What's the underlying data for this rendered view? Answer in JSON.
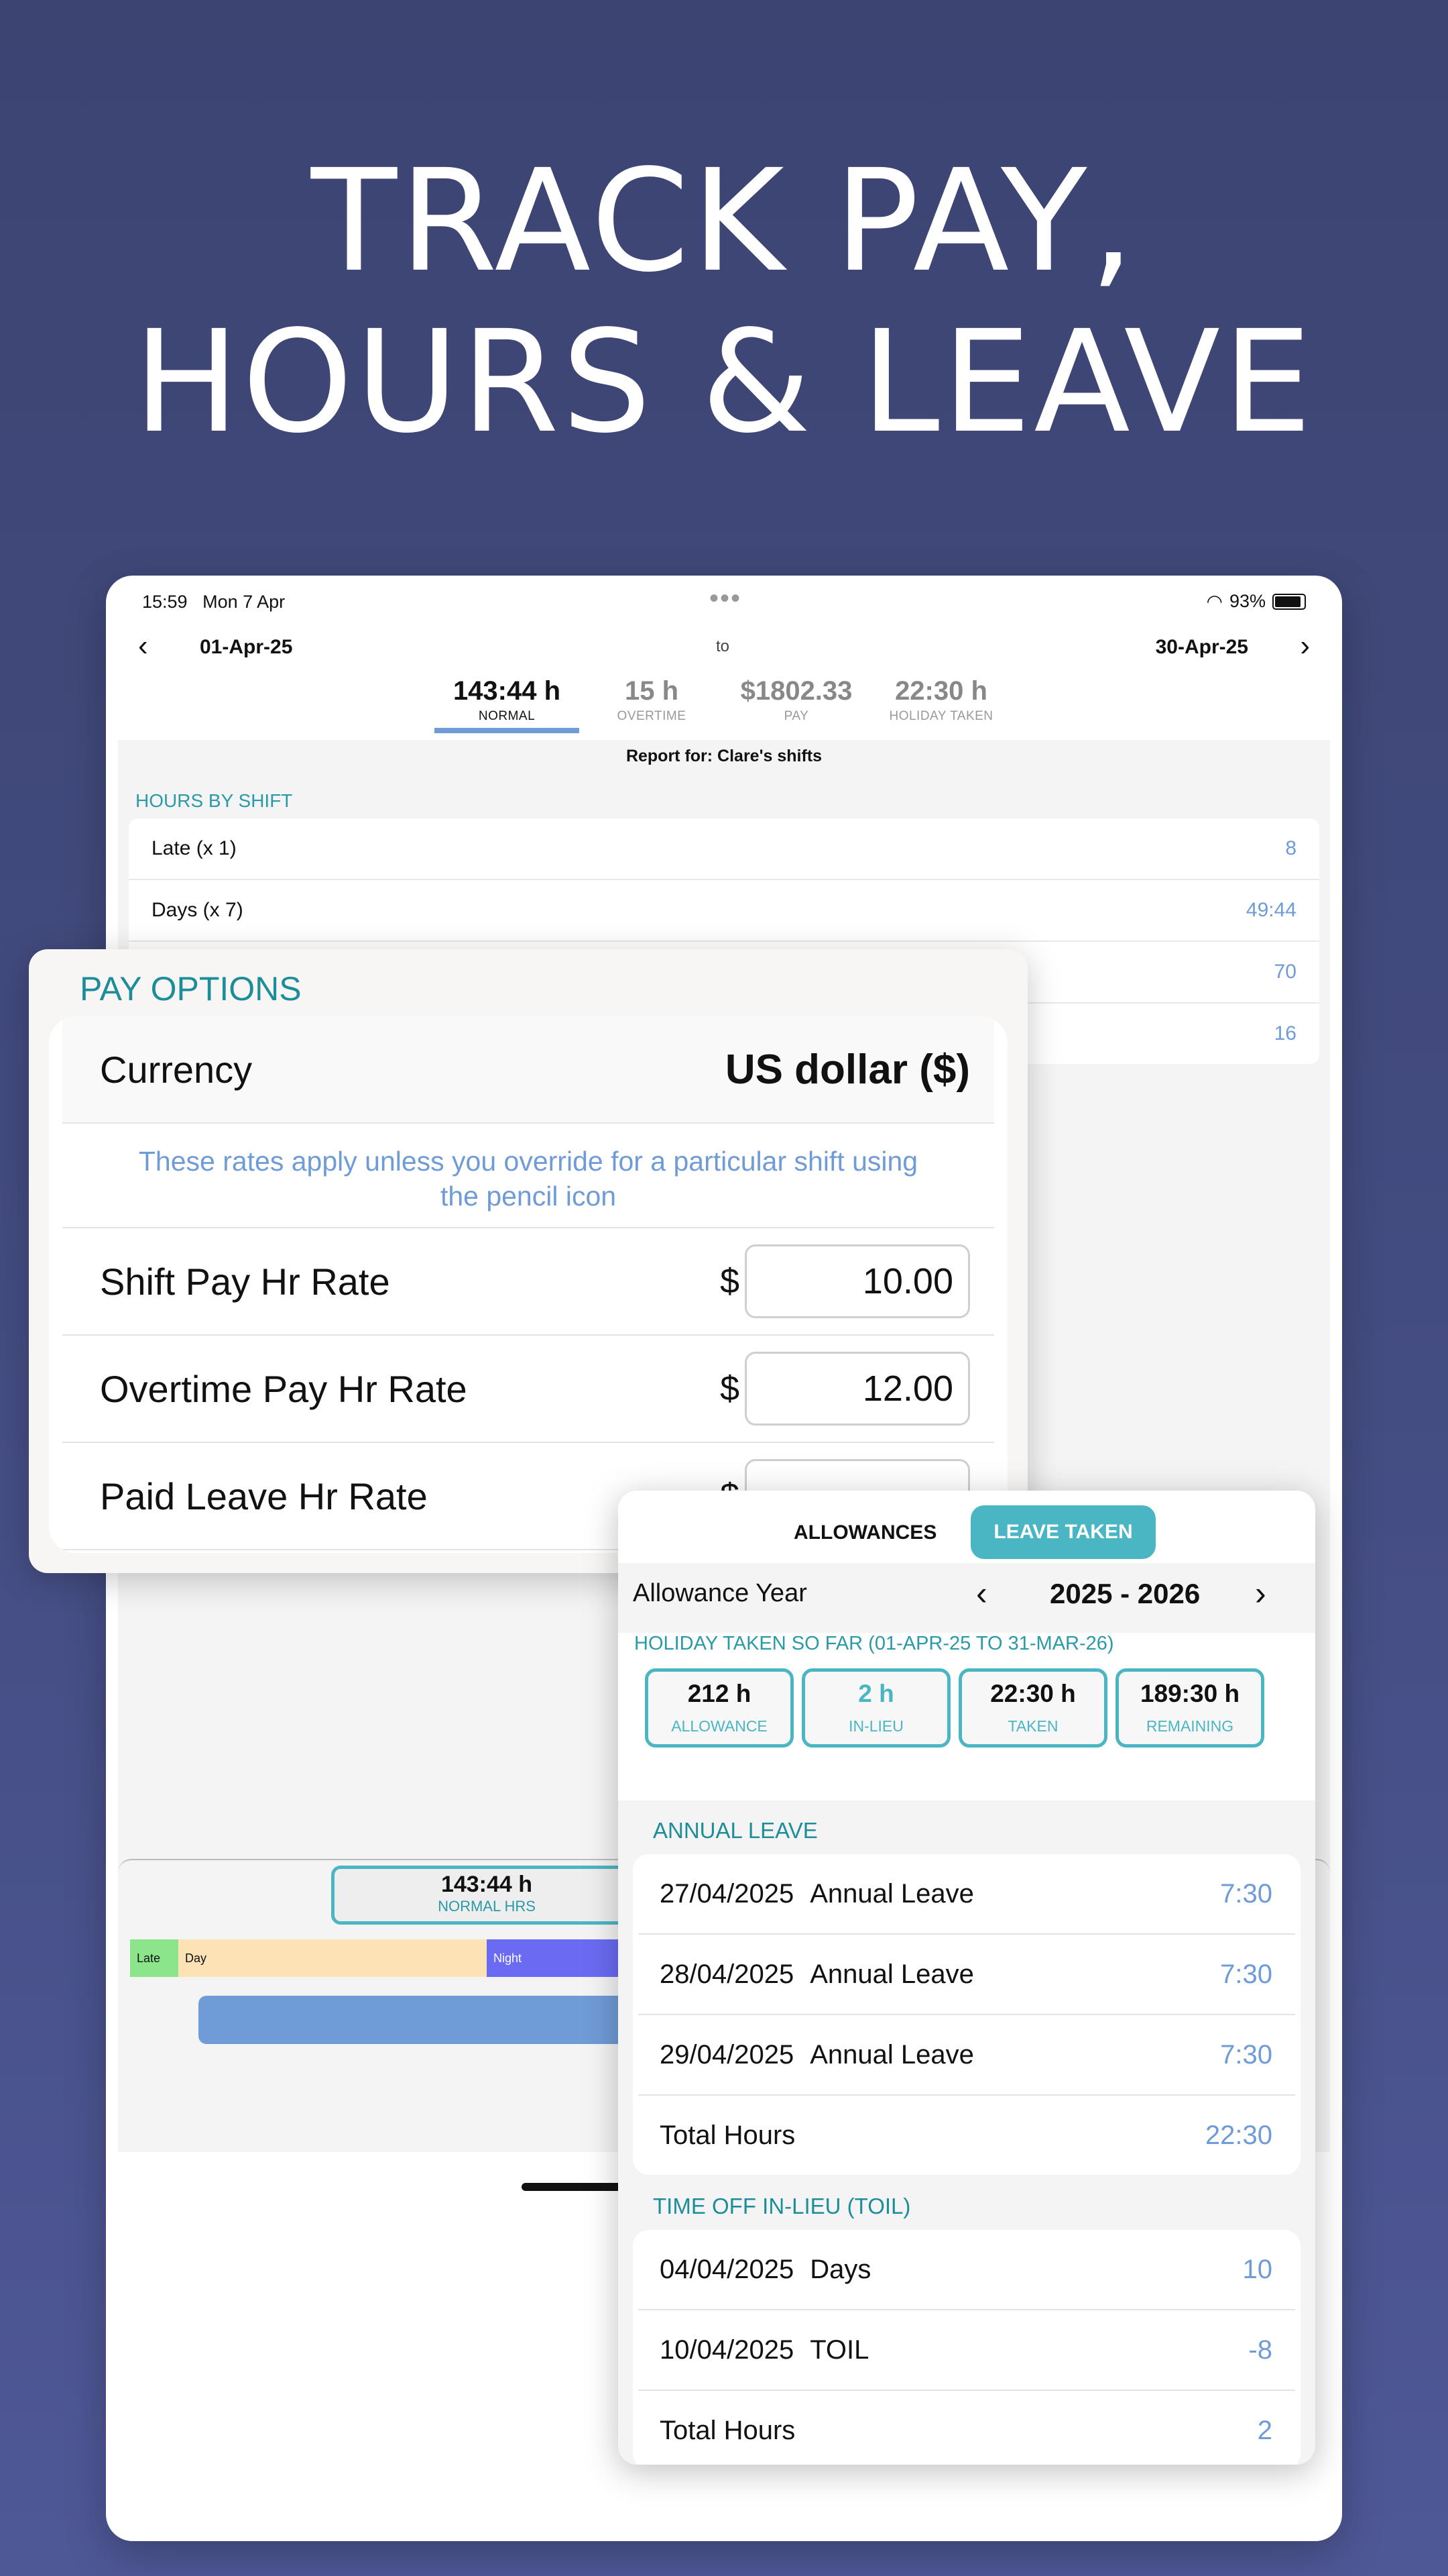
{
  "headline": {
    "line1": "TRACK PAY,",
    "line2": "HOURS & LEAVE"
  },
  "status": {
    "time": "15:59",
    "date": "Mon 7 Apr",
    "battery": "93%"
  },
  "datenav": {
    "from": "01-Apr-25",
    "to_label": "to",
    "until": "30-Apr-25"
  },
  "summary": [
    {
      "value": "143:44 h",
      "label": "NORMAL"
    },
    {
      "value": "15 h",
      "label": "OVERTIME"
    },
    {
      "value": "$1802.33",
      "label": "PAY"
    },
    {
      "value": "22:30 h",
      "label": "HOLIDAY TAKEN"
    }
  ],
  "report": {
    "title": "Report for: Clare's shifts"
  },
  "hours_by_shift": {
    "title": "HOURS BY SHIFT",
    "rows": [
      {
        "label": "Late (x 1)",
        "value": "8"
      },
      {
        "label": "Days (x 7)",
        "value": "49:44"
      },
      {
        "label": "",
        "value": "70"
      },
      {
        "label": "",
        "value": "16"
      }
    ]
  },
  "bottom": {
    "hours_value": "143:44 h",
    "hours_label": "NORMAL HRS",
    "segments": {
      "late": "Late",
      "day": "Day",
      "night": "Night"
    }
  },
  "pay_options": {
    "title": "PAY OPTIONS",
    "currency_label": "Currency",
    "currency_value": "US dollar ($)",
    "note": "These rates apply unless you override for a particular shift using the pencil icon",
    "rates": [
      {
        "label": "Shift Pay Hr Rate",
        "symbol": "$",
        "value": "10.00"
      },
      {
        "label": "Overtime Pay Hr Rate",
        "symbol": "$",
        "value": "12.00"
      },
      {
        "label": "Paid Leave Hr Rate",
        "symbol": "$",
        "value": ""
      }
    ]
  },
  "leave": {
    "tabs": {
      "allowances": "ALLOWANCES",
      "leave_taken": "LEAVE TAKEN"
    },
    "year_label": "Allowance Year",
    "year_value": "2025 - 2026",
    "holiday_title": "HOLIDAY TAKEN SO FAR (01-APR-25 TO 31-MAR-26)",
    "stats": [
      {
        "value": "212 h",
        "label": "ALLOWANCE"
      },
      {
        "value": "2 h",
        "label": "IN-LIEU"
      },
      {
        "value": "22:30 h",
        "label": "TAKEN"
      },
      {
        "value": "189:30 h",
        "label": "REMAINING"
      }
    ],
    "annual": {
      "title": "ANNUAL LEAVE",
      "rows": [
        {
          "date": "27/04/2025",
          "type": "Annual Leave",
          "value": "7:30"
        },
        {
          "date": "28/04/2025",
          "type": "Annual Leave",
          "value": "7:30"
        },
        {
          "date": "29/04/2025",
          "type": "Annual Leave",
          "value": "7:30"
        }
      ],
      "total_label": "Total Hours",
      "total_value": "22:30"
    },
    "toil": {
      "title": "TIME OFF IN-LIEU (TOIL)",
      "rows": [
        {
          "date": "04/04/2025",
          "type": "Days",
          "value": "10"
        },
        {
          "date": "10/04/2025",
          "type": "TOIL",
          "value": "-8"
        }
      ],
      "total_label": "Total Hours",
      "total_value": "2"
    }
  }
}
